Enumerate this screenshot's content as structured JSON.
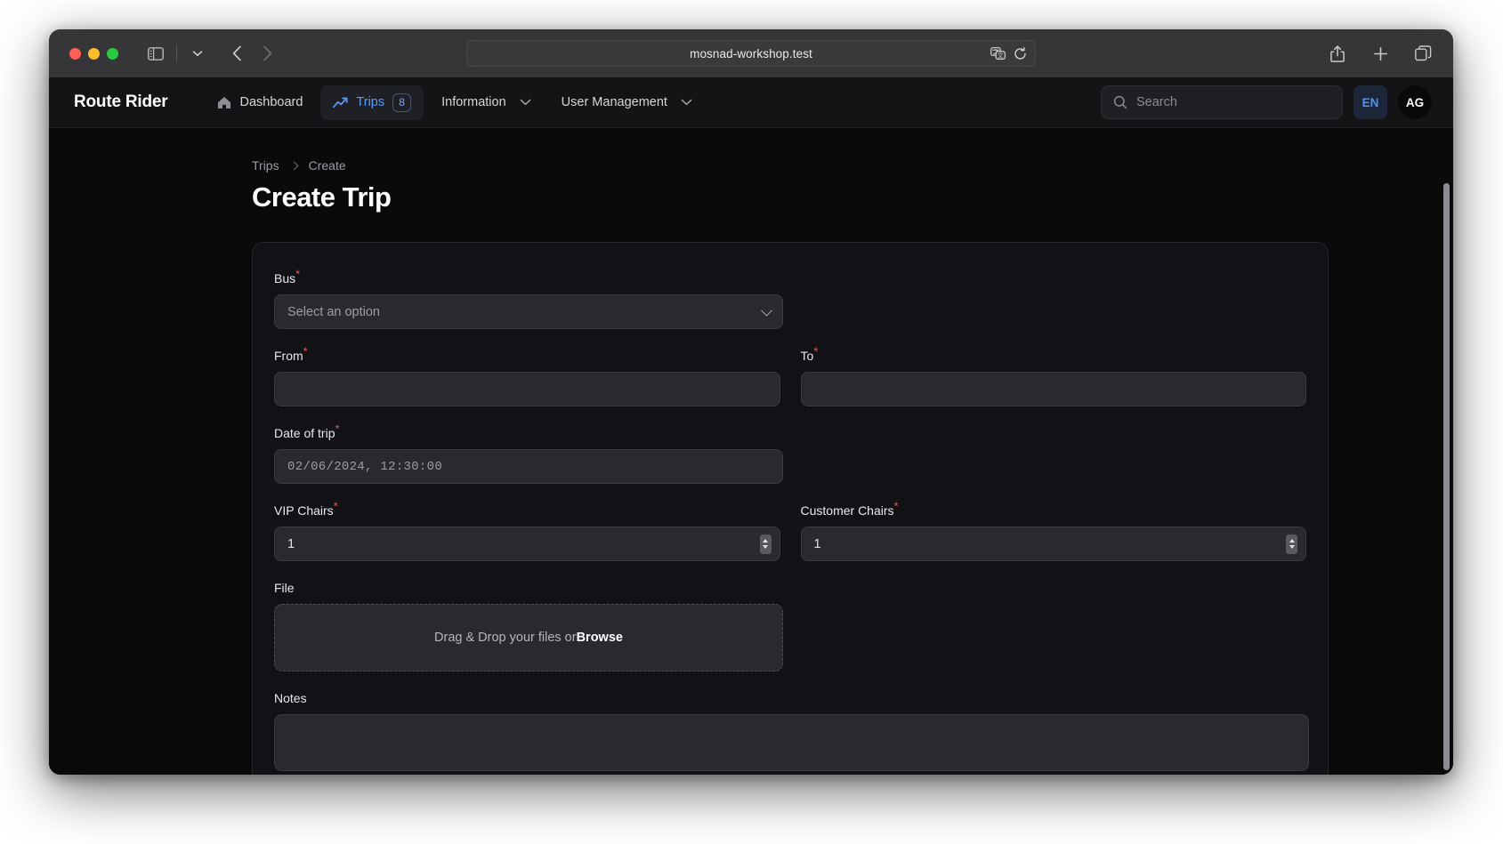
{
  "browser": {
    "url": "mosnad-workshop.test",
    "traffic_lights": [
      "close",
      "minimize",
      "maximize"
    ],
    "toolbar_icons": [
      "sidebar-icon",
      "tab-overview-chevron-icon",
      "back-icon",
      "forward-icon"
    ],
    "url_icons": [
      "translate-icon",
      "reload-icon"
    ],
    "right_icons": [
      "share-icon",
      "new-tab-icon",
      "tab-overview-icon"
    ]
  },
  "app": {
    "brand": "Route Rider",
    "nav": [
      {
        "label": "Dashboard",
        "icon": "home-icon",
        "active": false,
        "badge": null,
        "caret": false
      },
      {
        "label": "Trips",
        "icon": "trending-up-icon",
        "active": true,
        "badge": "8",
        "caret": false
      },
      {
        "label": "Information",
        "icon": null,
        "active": false,
        "badge": null,
        "caret": true
      },
      {
        "label": "User Management",
        "icon": null,
        "active": false,
        "badge": null,
        "caret": true
      }
    ],
    "search": {
      "placeholder": "Search",
      "icon": "search-icon"
    },
    "language": "EN",
    "avatar": "AG"
  },
  "page": {
    "breadcrumb": {
      "parent": "Trips",
      "current": "Create"
    },
    "title": "Create Trip"
  },
  "form": {
    "bus": {
      "label": "Bus",
      "required": "*",
      "value": "Select an option",
      "type": "select"
    },
    "from": {
      "label": "From",
      "required": "*",
      "value": "",
      "type": "text"
    },
    "to": {
      "label": "To",
      "required": "*",
      "value": "",
      "type": "text"
    },
    "date_of_trip": {
      "label": "Date of trip",
      "required": "*",
      "placeholder": "02/06/2024, 12:30:00",
      "value": "",
      "type": "datetime"
    },
    "vip_chairs": {
      "label": "VIP Chairs",
      "required": "*",
      "value": "1",
      "type": "number"
    },
    "customer_chairs": {
      "label": "Customer Chairs",
      "required": "*",
      "value": "1",
      "type": "number"
    },
    "file": {
      "label": "File",
      "required": "",
      "dropzone_text": "Drag & Drop your files or ",
      "browse_label": "Browse",
      "type": "file"
    },
    "notes": {
      "label": "Notes",
      "required": "",
      "value": "",
      "type": "textarea"
    }
  },
  "colors": {
    "accent": "#5b9cf8",
    "required_asterisk": "#e05a5a",
    "page_bg": "#0a0a0b",
    "card_bg": "#121216",
    "input_bg": "#2a2a2e"
  }
}
